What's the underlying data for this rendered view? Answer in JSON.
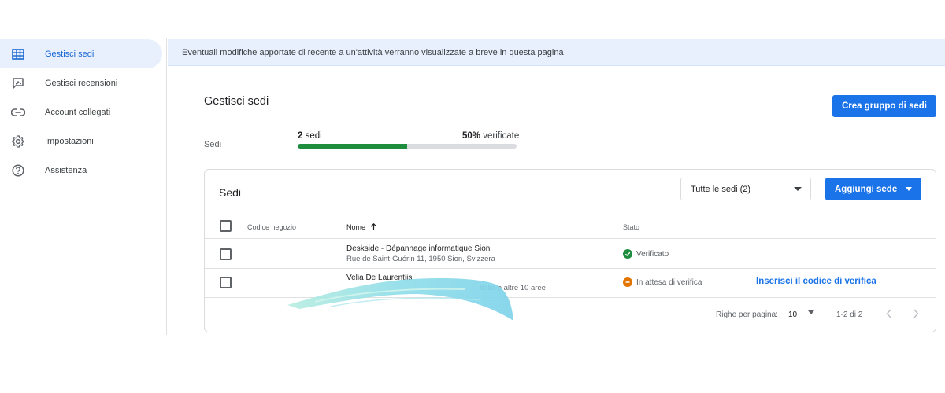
{
  "sidebar": {
    "items": [
      {
        "label": "Gestisci sedi",
        "icon": "building-grid-icon"
      },
      {
        "label": "Gestisci recensioni",
        "icon": "review-chat-icon"
      },
      {
        "label": "Account collegati",
        "icon": "link-icon"
      },
      {
        "label": "Impostazioni",
        "icon": "gear-icon"
      },
      {
        "label": "Assistenza",
        "icon": "help-icon"
      }
    ]
  },
  "banner": {
    "text": "Eventuali modifiche apportate di recente a un'attività verranno visualizzate a breve in questa pagina"
  },
  "header": {
    "title": "Gestisci sedi",
    "create_group_label": "Crea gruppo di sedi"
  },
  "progress": {
    "label": "Sedi",
    "count_value": "2",
    "count_unit": "sedi",
    "percent_value": "50%",
    "percent_unit": "verificate",
    "fraction": 0.5,
    "fill_color": "#1e8e3e"
  },
  "card": {
    "title": "Sedi",
    "filter": {
      "selected": "Tutte le sedi (2)"
    },
    "add_label": "Aggiungi sede",
    "columns": {
      "store_code": "Codice negozio",
      "name": "Nome",
      "status": "Stato"
    },
    "rows": [
      {
        "name": "Deskside - Dépannage informatique Sion",
        "address": "Rue de Saint-Guérin 11, 1950 Sion, Svizzera",
        "status": "Verificato",
        "status_color": "#1e8e3e",
        "action": ""
      },
      {
        "name": "Velia De Laurentiis",
        "address": "Italia e altre 10 aree",
        "status": "In attesa di verifica",
        "status_color": "#e37400",
        "action": "Inserisci il codice di verifica"
      }
    ],
    "footer": {
      "rows_per_page_label": "Righe per pagina:",
      "rows_per_page_value": "10",
      "range": "1-2 di 2"
    }
  },
  "colors": {
    "accent": "#1a73e8",
    "banner_bg": "#e8f0fe",
    "redaction": "#7fd6e6"
  }
}
